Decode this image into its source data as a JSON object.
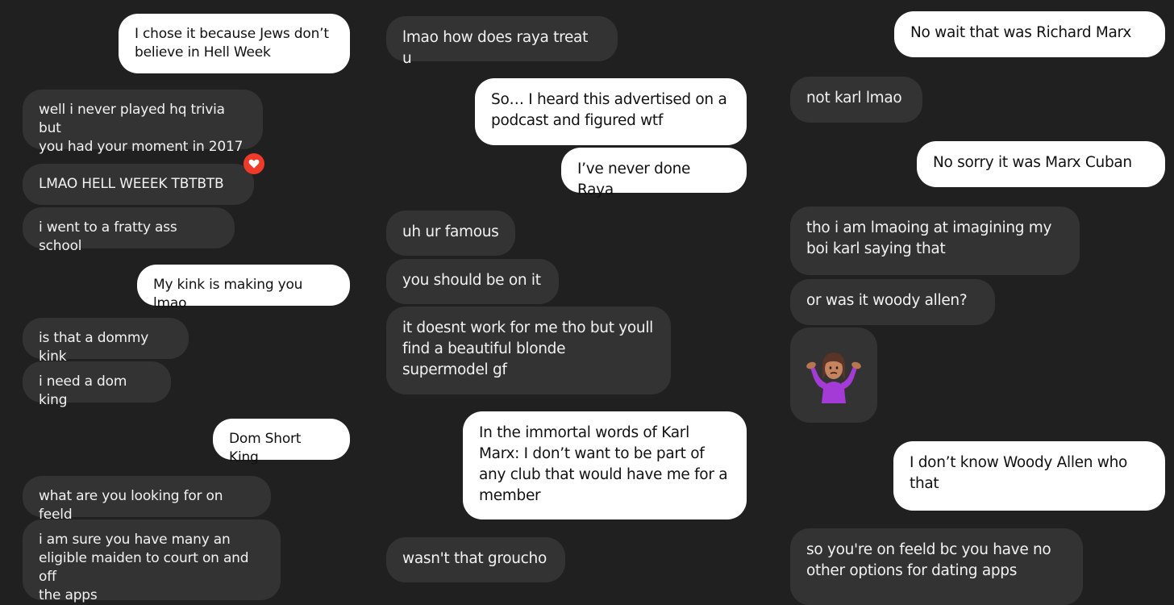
{
  "col1": [
    {
      "text": "I chose it because Jews don’t\nbelieve in Hell Week",
      "dir": "out"
    },
    {
      "text": "well i never played hq trivia but\nyou had your moment in 2017",
      "dir": "in"
    },
    {
      "text": "LMAO HELL WEEEK TBTBTB",
      "dir": "in",
      "reaction": "heart-icon"
    },
    {
      "text": "i went to a fratty ass school",
      "dir": "in"
    },
    {
      "text": "My kink is making you lmao",
      "dir": "out"
    },
    {
      "text": "is that a dommy kink",
      "dir": "in"
    },
    {
      "text": "i need a dom king",
      "dir": "in"
    },
    {
      "text": "Dom Short King",
      "dir": "out"
    },
    {
      "text": "what are you looking for on feeld",
      "dir": "in"
    },
    {
      "text": "i am sure you have many an\neligible maiden to court on and off\nthe apps",
      "dir": "in"
    }
  ],
  "col2": [
    {
      "text": "lmao how does raya treat u",
      "dir": "in"
    },
    {
      "text": "So… I heard this advertised on a\npodcast and figured wtf",
      "dir": "out"
    },
    {
      "text": "I’ve never done Raya",
      "dir": "out"
    },
    {
      "text": "uh ur famous",
      "dir": "in"
    },
    {
      "text": "you should be on it",
      "dir": "in"
    },
    {
      "text": "it doesnt work for me tho but youll\nfind a beautiful blonde\nsupermodel gf",
      "dir": "in"
    },
    {
      "text": "In the immortal words of Karl\nMarx: I don’t want to be part of\nany club that would have me for a\nmember",
      "dir": "out"
    },
    {
      "text": "wasn't that groucho",
      "dir": "in"
    }
  ],
  "col3": [
    {
      "text": "No wait that was Richard Marx",
      "dir": "out"
    },
    {
      "text": "not karl lmao",
      "dir": "in"
    },
    {
      "text": "No sorry it was Marx Cuban",
      "dir": "out"
    },
    {
      "text": "tho i am lmaoing at imagining my\nboi karl saying that",
      "dir": "in"
    },
    {
      "text": "or was it woody allen?",
      "dir": "in"
    },
    {
      "emoji": "person-shrugging-emoji",
      "dir": "in"
    },
    {
      "text": "I don’t know Woody Allen who\nthat",
      "dir": "out"
    },
    {
      "text": "so you're on feeld bc you have no\nother options for dating apps",
      "dir": "in"
    }
  ],
  "colors": {
    "background": "#202020",
    "incoming": "#333333",
    "outgoing": "#ffffff",
    "reaction": "#ef3a2a"
  }
}
